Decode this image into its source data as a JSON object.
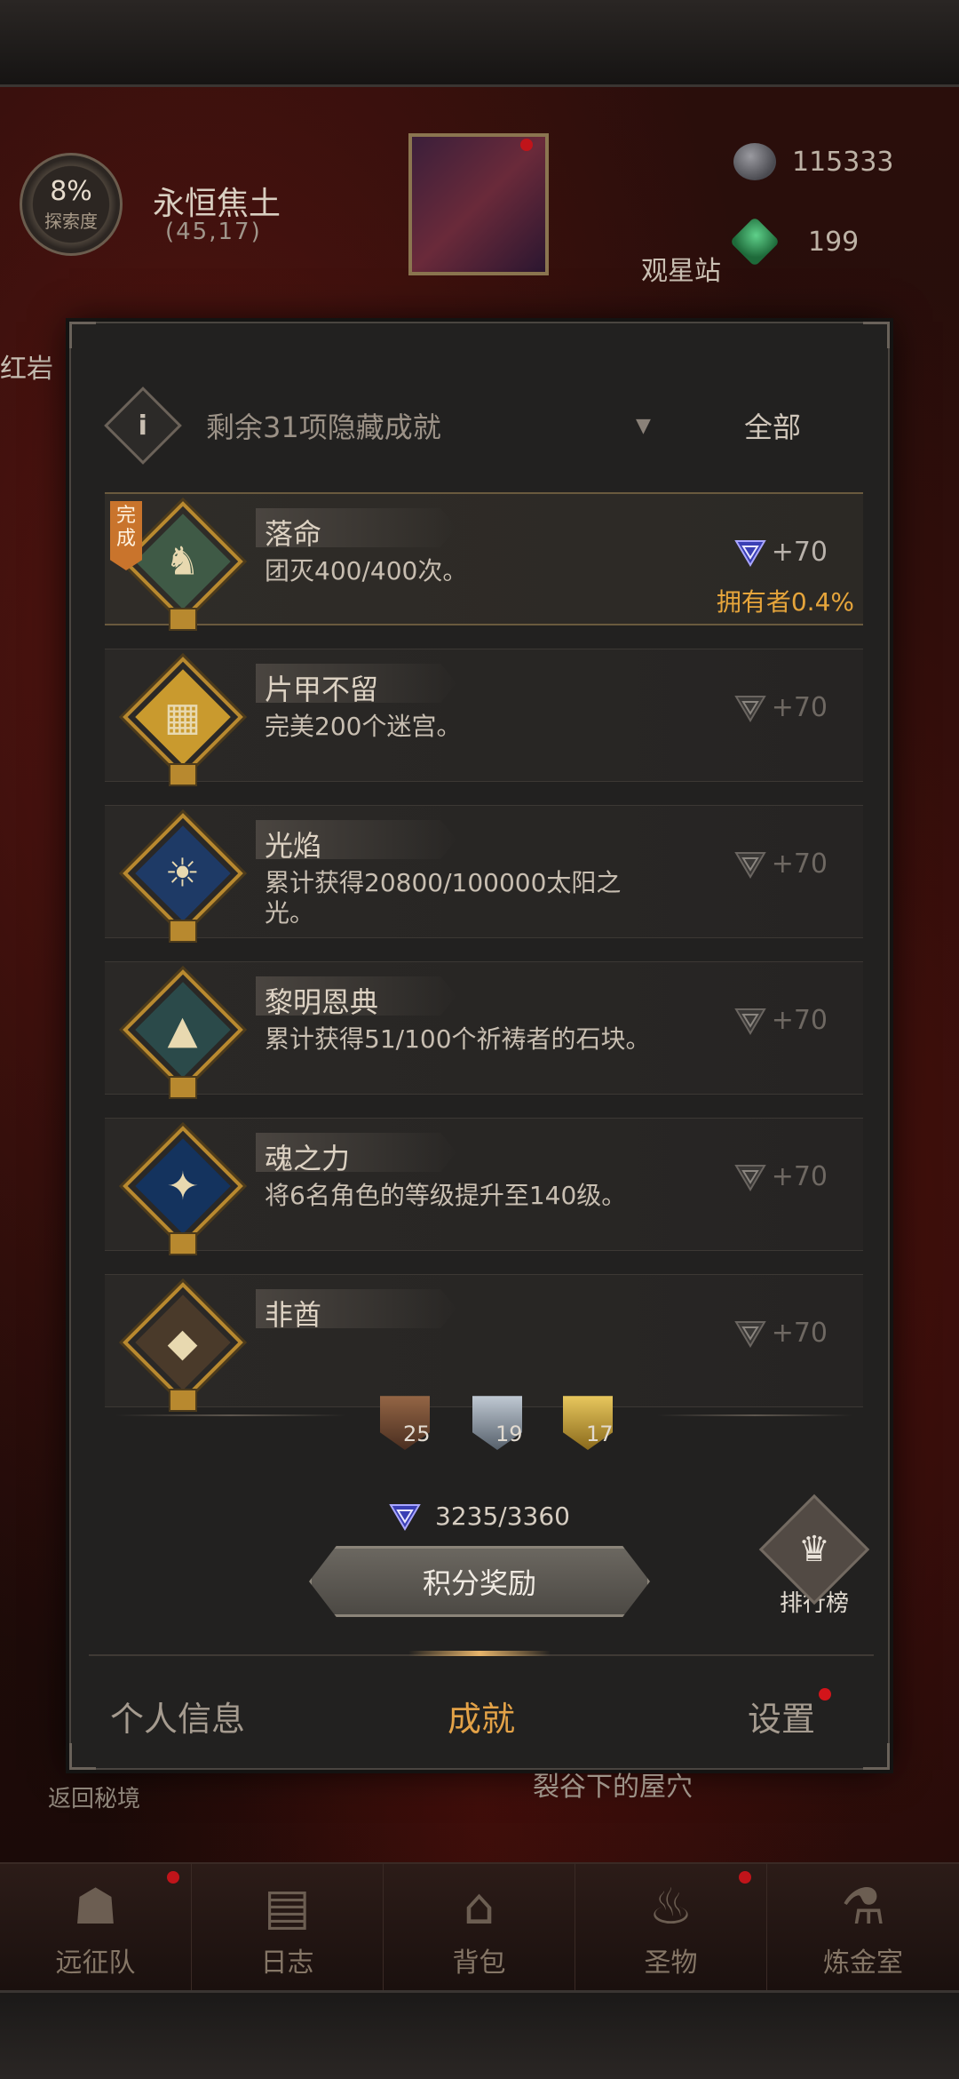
{
  "hud": {
    "explore_percent": "8%",
    "explore_label": "探索度",
    "region_name": "永恒焦土",
    "region_coord": "(45,17)",
    "observatory": "观星站",
    "resource_1": "115333",
    "resource_2": "199",
    "red_tag": "红岩"
  },
  "panel": {
    "filter_text": "剩余31项隐藏成就",
    "filter_caret": "▼",
    "filter_all": "全部",
    "achievements": [
      {
        "title": "落命",
        "desc": "团灭400/400次。",
        "points": "+70",
        "done": true,
        "done_label": "完成",
        "owner": "拥有者0.4%",
        "badge_color": "#3f5a46",
        "glyph": "♞",
        "icon": "skull-statue-icon"
      },
      {
        "title": "片甲不留",
        "desc": "完美200个迷宫。",
        "points": "+70",
        "done": false,
        "badge_color": "#c99a2e",
        "glyph": "▦",
        "icon": "maze-icon"
      },
      {
        "title": "光焰",
        "desc": "累计获得20800/100000太阳之光。",
        "points": "+70",
        "done": false,
        "badge_color": "#1e3a66",
        "glyph": "☀",
        "icon": "sun-jar-icon"
      },
      {
        "title": "黎明恩典",
        "desc": "累计获得51/100个祈祷者的石块。",
        "points": "+70",
        "done": false,
        "badge_color": "#2b4a4a",
        "glyph": "▲",
        "icon": "stones-icon"
      },
      {
        "title": "魂之力",
        "desc": "将6名角色的等级提升至140级。",
        "points": "+70",
        "done": false,
        "badge_color": "#14335e",
        "glyph": "✦",
        "icon": "blue-flame-icon"
      },
      {
        "title": "非酋",
        "desc": "",
        "points": "+70",
        "done": false,
        "badge_color": "#4a3a2a",
        "glyph": "◆",
        "icon": "partial-badge-icon"
      }
    ],
    "medal_counts": [
      "25",
      "19",
      "17"
    ],
    "score": "3235/3360",
    "reward_button": "积分奖励",
    "rank_label": "排行榜",
    "tabs": [
      "个人信息",
      "成就",
      "设置"
    ]
  },
  "under": {
    "return": "返回秘境",
    "location": "裂谷下的屋穴"
  },
  "nav": [
    "远征队",
    "日志",
    "背包",
    "圣物",
    "炼金室"
  ]
}
